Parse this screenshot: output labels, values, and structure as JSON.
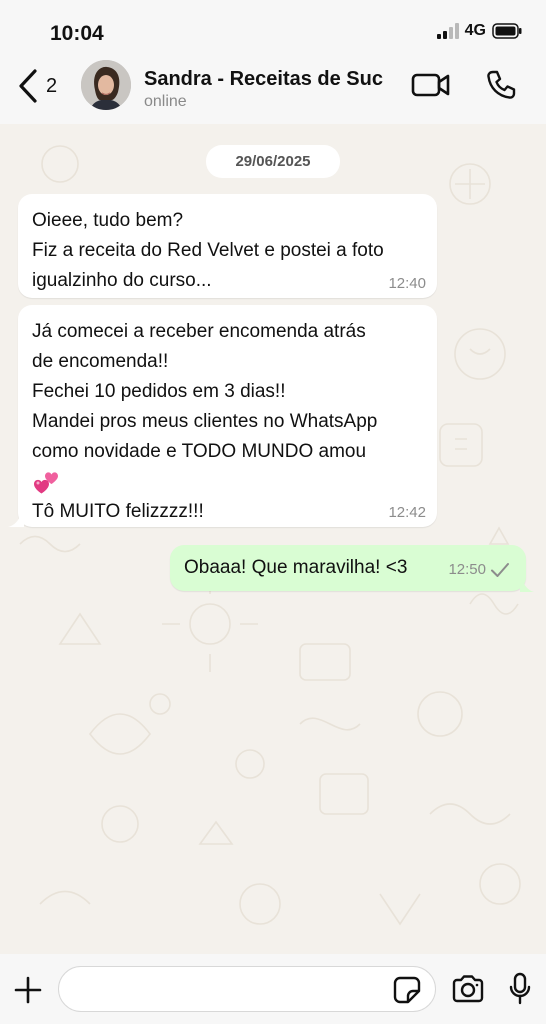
{
  "status_bar": {
    "time": "10:04",
    "network": "4G"
  },
  "header": {
    "back_count": "2",
    "contact_name": "Sandra - Receitas de Suc",
    "contact_status": "online",
    "icons": [
      "back-chevron-icon",
      "video-camera-icon",
      "phone-icon"
    ]
  },
  "chat": {
    "date": "29/06/2025",
    "messages": [
      {
        "direction": "incoming",
        "lines": [
          "Oieee, tudo bem?",
          "Fiz a receita do Red Velvet e postei a foto",
          "igualzinho do curso..."
        ],
        "time": "12:40"
      },
      {
        "direction": "incoming",
        "lines": [
          "Já comecei a receber encomenda atrás",
          "de encomenda!!",
          "Fechei 10 pedidos em 3 dias!!",
          "Mandei pros meus clientes no WhatsApp",
          "como novidade e TODO MUNDO amou",
          "",
          "Tô MUITO felizzzz!!!"
        ],
        "emoji": "two-hearts-icon",
        "time": "12:42"
      },
      {
        "direction": "outgoing",
        "lines": [
          "Obaaa! Que maravilha! <3"
        ],
        "time": "12:50",
        "status": "single-check-icon"
      }
    ]
  },
  "input_bar": {
    "message_value": "",
    "icons": [
      "plus-icon",
      "sticker-icon",
      "camera-icon",
      "microphone-icon"
    ]
  },
  "colors": {
    "incoming_bubble": "#ffffff",
    "outgoing_bubble": "#d9fdd3",
    "wallpaper": "#f4f1ec",
    "bars": "#f7f7f7",
    "emoji_heart": "#e8408a"
  }
}
